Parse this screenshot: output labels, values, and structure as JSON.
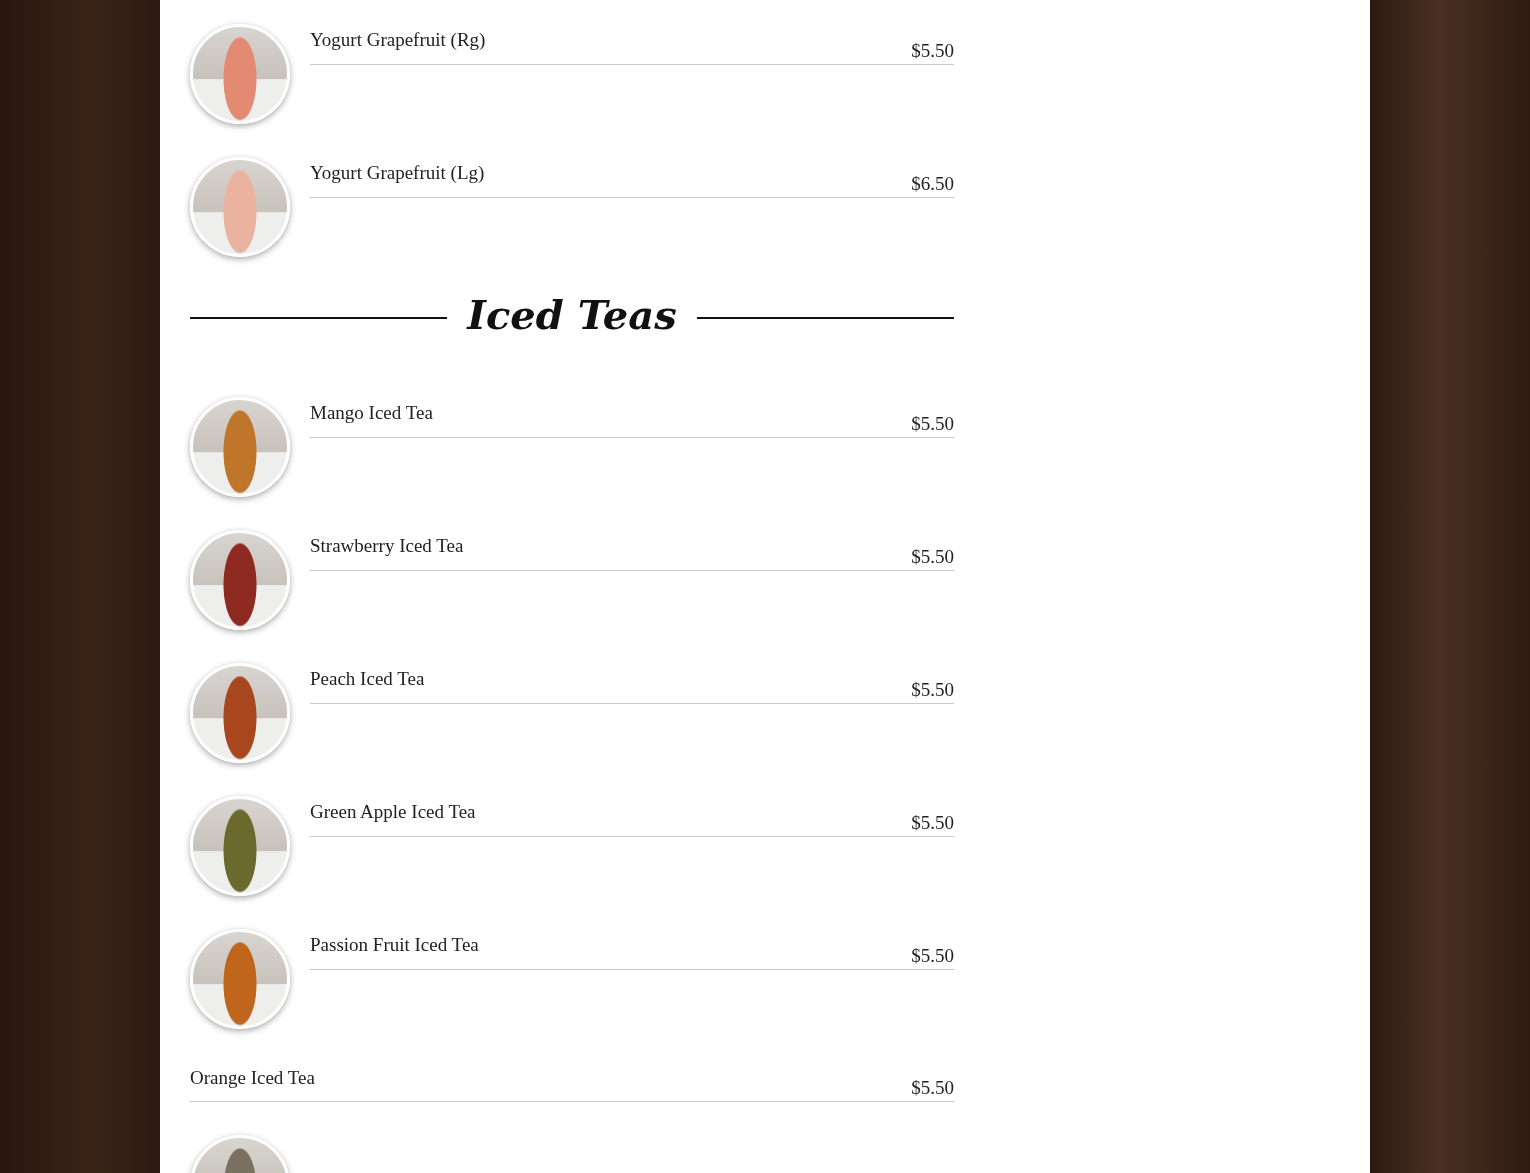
{
  "sections": [
    {
      "items": [
        {
          "kind": "photo",
          "name": "Yogurt Grapefruit (Rg)",
          "price": "$5.50",
          "color": "#e48a72"
        },
        {
          "kind": "photo",
          "name": "Yogurt Grapefruit (Lg)",
          "price": "$6.50",
          "color": "#eab3a0"
        }
      ]
    },
    {
      "title": "Iced Teas",
      "items": [
        {
          "kind": "photo",
          "name": "Mango Iced Tea",
          "price": "$5.50",
          "color": "#c0762a"
        },
        {
          "kind": "photo",
          "name": "Strawberry Iced Tea",
          "price": "$5.50",
          "color": "#8e2a22"
        },
        {
          "kind": "photo",
          "name": "Peach Iced Tea",
          "price": "$5.50",
          "color": "#a8461e"
        },
        {
          "kind": "photo",
          "name": "Green Apple Iced Tea",
          "price": "$5.50",
          "color": "#6a6a2e"
        },
        {
          "kind": "photo",
          "name": "Passion Fruit Iced Tea",
          "price": "$5.50",
          "color": "#c0661c"
        },
        {
          "kind": "text",
          "name": "Orange Iced Tea",
          "price": "$5.50"
        },
        {
          "kind": "photo-cut",
          "color": "#7a7060"
        }
      ]
    }
  ]
}
